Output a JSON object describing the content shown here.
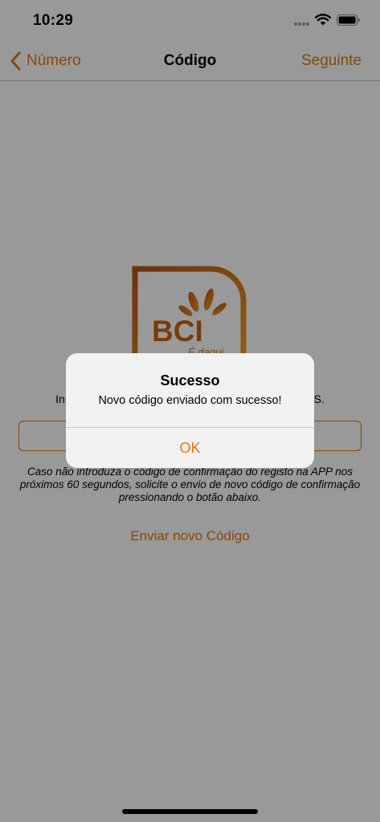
{
  "status_bar": {
    "time": "10:29"
  },
  "nav": {
    "back_label": "Número",
    "title": "Código",
    "next_label": "Seguinte"
  },
  "logo": {
    "brand": "BCI",
    "tagline": "É daqui"
  },
  "content": {
    "instruction": "Insira o código de confirmação que recebeu por SMS.",
    "code_input_value": "",
    "code_input_placeholder": "",
    "info_text": "Caso não introduza o código de confirmação do registo na APP nos próximos 60 segundos, solicite o envio de novo código de confirmação pressionando o botão abaixo.",
    "resend_label": "Enviar novo Código"
  },
  "alert": {
    "title": "Sucesso",
    "message": "Novo código enviado com sucesso!",
    "ok_label": "OK"
  },
  "colors": {
    "accent": "#e07a10",
    "logo_gradient_start": "#b8521a",
    "logo_gradient_end": "#f0a020"
  }
}
